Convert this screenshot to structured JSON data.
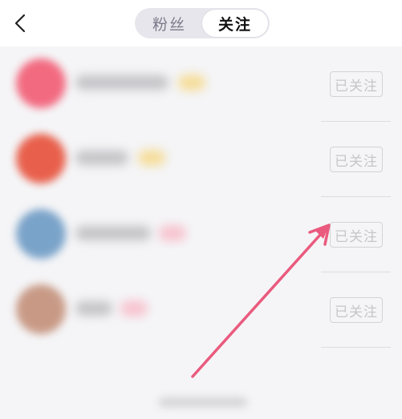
{
  "header": {
    "back_icon": "chevron-left-icon",
    "tabs": [
      {
        "label": "粉丝",
        "selected": false
      },
      {
        "label": "关注",
        "selected": true
      }
    ]
  },
  "following_list": [
    {
      "button_label": "已关注",
      "avatar_color": "#f26a80",
      "badge_color": "#f5dd9a"
    },
    {
      "button_label": "已关注",
      "avatar_color": "#e8604c",
      "badge_color": "#f5dd9a"
    },
    {
      "button_label": "已关注",
      "avatar_color": "#7aa3c9",
      "badge_color": "#f7c4cf"
    },
    {
      "button_label": "已关注",
      "avatar_color": "#c89a86",
      "badge_color": "#f7c4cf"
    }
  ],
  "annotation": {
    "arrow_color": "#ea5a7e",
    "arrow_icon": "pointer-arrow-icon"
  },
  "colors": {
    "list_background": "#f5f5f7",
    "segment_background": "#e7e6ec"
  }
}
